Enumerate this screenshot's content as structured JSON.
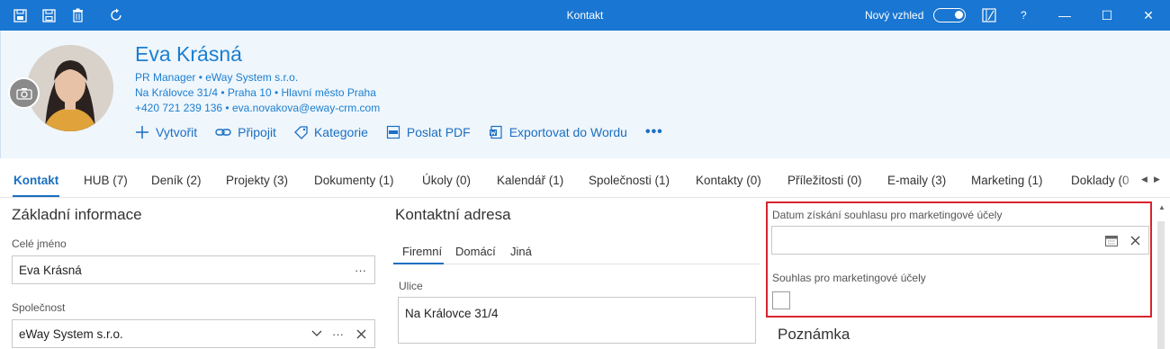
{
  "window": {
    "title": "Kontakt",
    "toggle_label": "Nový vzhled",
    "help_label": "?",
    "controls": {
      "minimize": "—",
      "maximize": "☐",
      "close": "✕"
    },
    "accent_color": "#1976d2"
  },
  "contact": {
    "name": "Eva Krásná",
    "role_company": "PR Manager • eWay System s.r.o.",
    "address": "Na Královce 31/4 • Praha 10 • Hlavní město Praha",
    "phone_email": "+420 721 239 136 • eva.novakova@eway-crm.com"
  },
  "actions": [
    {
      "label": "Vytvořit",
      "icon": "plus-icon"
    },
    {
      "label": "Připojit",
      "icon": "link-icon"
    },
    {
      "label": "Kategorie",
      "icon": "tag-icon"
    },
    {
      "label": "Poslat PDF",
      "icon": "pdf-icon"
    },
    {
      "label": "Exportovat do Wordu",
      "icon": "word-icon"
    }
  ],
  "more_label": "•••",
  "tabs": [
    {
      "label": "Kontakt"
    },
    {
      "label": "HUB (7)"
    },
    {
      "label": "Deník (2)"
    },
    {
      "label": "Projekty (3)"
    },
    {
      "label": "Dokumenty (1)"
    },
    {
      "label": "Úkoly (0)"
    },
    {
      "label": "Kalendář (1)"
    },
    {
      "label": "Společnosti (1)"
    },
    {
      "label": "Kontakty (0)"
    },
    {
      "label": "Příležitosti (0)"
    },
    {
      "label": "E-maily (3)"
    },
    {
      "label": "Marketing (1)"
    },
    {
      "label": "Doklady (0"
    }
  ],
  "basic_info": {
    "title": "Základní informace",
    "full_name_label": "Celé jméno",
    "full_name_value": "Eva Krásná",
    "company_label": "Společnost",
    "company_value": "eWay System s.r.o."
  },
  "contact_address": {
    "title": "Kontaktní adresa",
    "subtabs": [
      "Firemní",
      "Domácí",
      "Jiná"
    ],
    "street_label": "Ulice",
    "street_value": "Na Královce 31/4"
  },
  "marketing": {
    "consent_date_label": "Datum získání souhlasu pro marketingové účely",
    "consent_date_value": "",
    "consent_label": "Souhlas pro marketingové účely",
    "consent_checked": false,
    "highlight_color": "#d9242f"
  },
  "note": {
    "title": "Poznámka"
  }
}
